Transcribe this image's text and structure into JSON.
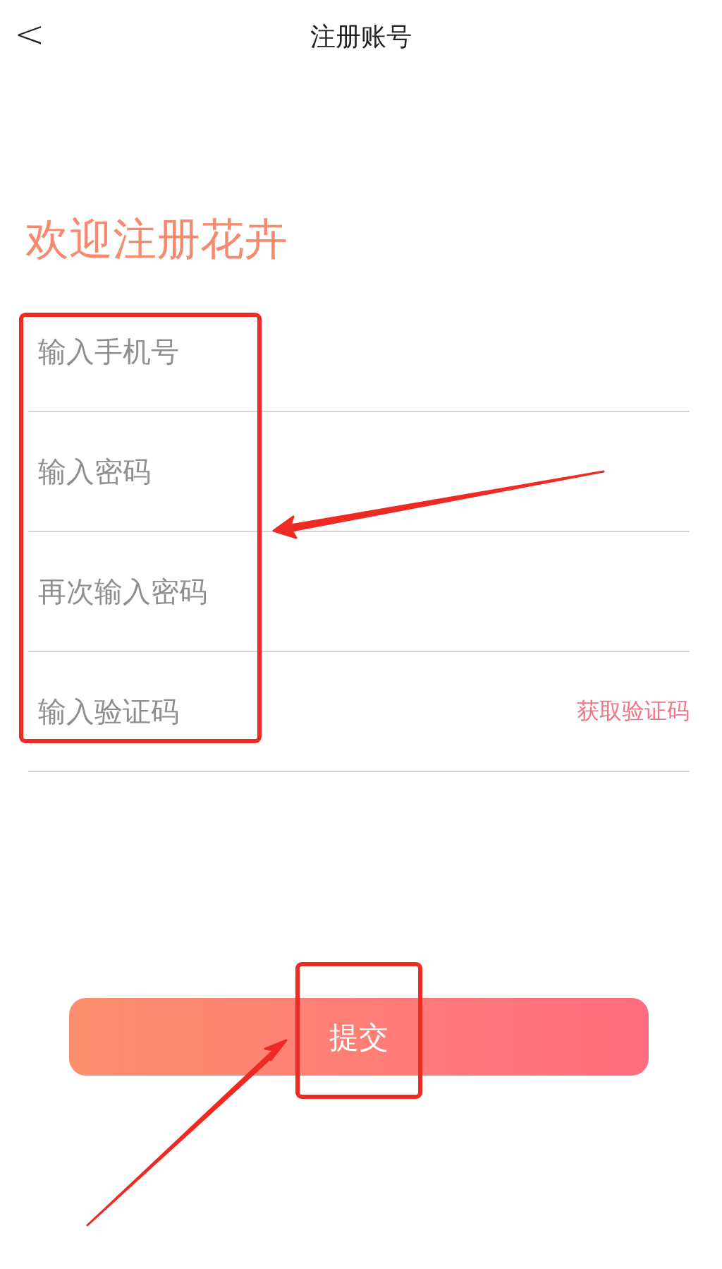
{
  "header": {
    "back": "<",
    "title": "注册账号"
  },
  "welcome": "欢迎注册花卉",
  "fields": [
    {
      "placeholder": "输入手机号"
    },
    {
      "placeholder": "输入密码"
    },
    {
      "placeholder": "再次输入密码"
    },
    {
      "placeholder": "输入验证码",
      "action": "获取验证码"
    }
  ],
  "submit": "提交"
}
